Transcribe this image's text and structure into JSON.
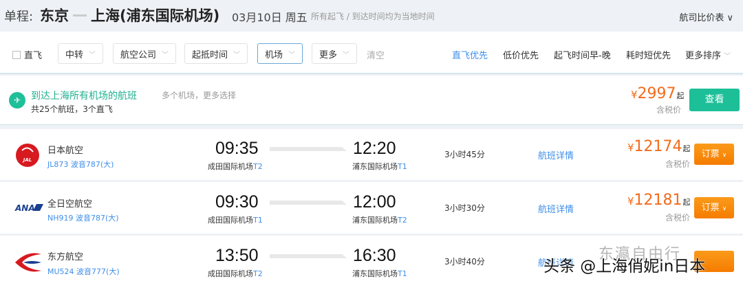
{
  "header": {
    "label": "单程:",
    "from": "东京",
    "to": "上海(浦东国际机场)",
    "date": "03月10日 周五",
    "note": "所有起飞 / 到达时间均为当地时间",
    "compare": "航司比价表 ∨"
  },
  "filters": {
    "direct": "直飞",
    "dropdowns": [
      "中转",
      "航空公司",
      "起抵时间",
      "机场",
      "更多"
    ],
    "clear": "清空",
    "sorts": [
      "直飞优先",
      "低价优先",
      "起飞时间早-晚",
      "耗时短优先",
      "更多排序"
    ]
  },
  "banner": {
    "title": "到达上海所有机场的航班",
    "sub": "共25个航班，3个直飞",
    "more": "多个机场，更多选择",
    "price": "2997",
    "currency": "¥",
    "from": "起",
    "tax": "含税价",
    "button": "查看"
  },
  "flights": [
    {
      "airline": "日本航空",
      "flight": "JL873 波音787(大)",
      "dep": "09:35",
      "dep_airport": "成田国际机场",
      "dep_term": "T2",
      "arr": "12:20",
      "arr_airport": "浦东国际机场",
      "arr_term": "T1",
      "duration": "3小时45分",
      "detail": "航班详情",
      "price": "12174",
      "tax": "含税价",
      "book": "订票"
    },
    {
      "airline": "全日空航空",
      "flight": "NH919 波音787(大)",
      "dep": "09:30",
      "dep_airport": "成田国际机场",
      "dep_term": "T1",
      "arr": "12:00",
      "arr_airport": "浦东国际机场",
      "arr_term": "T2",
      "duration": "3小时30分",
      "detail": "航班详情",
      "price": "12181",
      "tax": "含税价",
      "book": "订票"
    },
    {
      "airline": "东方航空",
      "flight": "MU524 波音777(大)",
      "dep": "13:50",
      "dep_airport": "成田国际机场",
      "dep_term": "T2",
      "arr": "16:30",
      "arr_airport": "浦东国际机场",
      "arr_term": "T1",
      "duration": "3小时40分",
      "detail": "航班详情"
    }
  ],
  "watermark": {
    "wechat": "东瀛自由行",
    "toutiao": "头条 @上海俏妮in日本"
  },
  "logos": {
    "jal": "JAL",
    "ana": "ANA"
  }
}
